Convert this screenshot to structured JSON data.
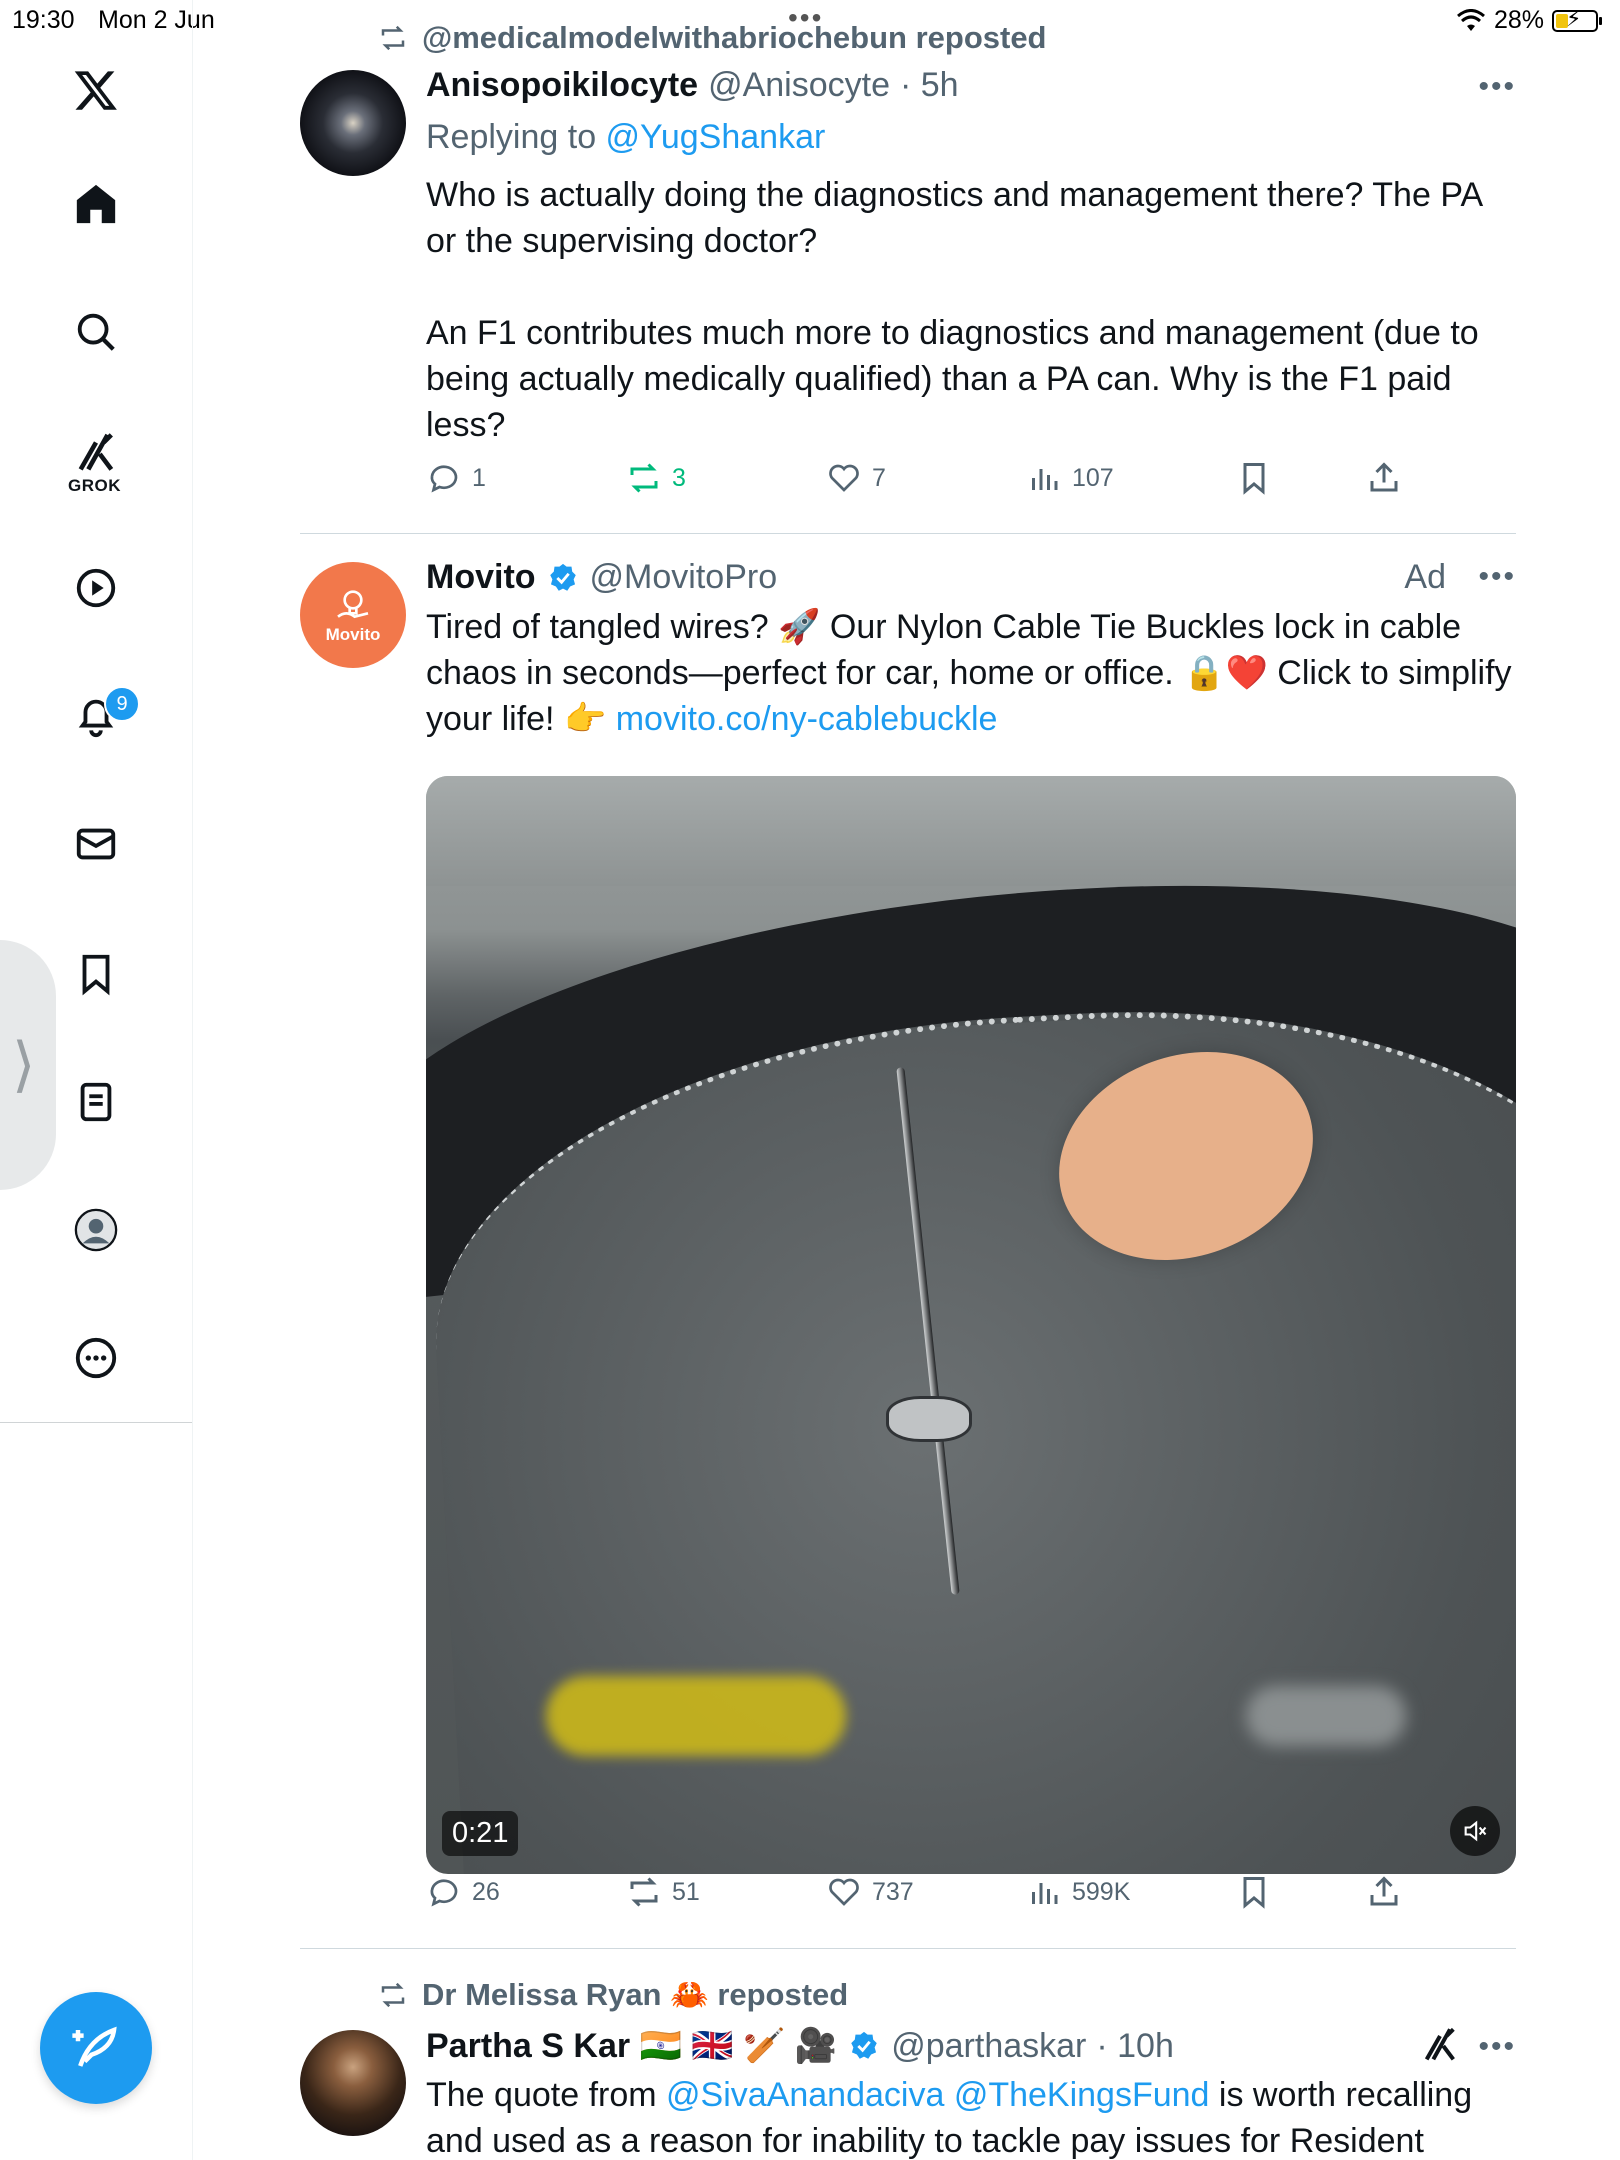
{
  "status_bar": {
    "time": "19:30",
    "date": "Mon 2 Jun",
    "battery": "28%",
    "battery_level": 0.28
  },
  "nav": {
    "grok_label": "GROK",
    "notifications_count": "9"
  },
  "posts": [
    {
      "repost_by": "@medicalmodelwithabriochebun reposted",
      "name": "Anisopoikilocyte",
      "handle": "@Anisocyte",
      "time": "· 5h",
      "replying_prefix": "Replying to ",
      "replying_to": "@YugShankar",
      "text_p1": "Who is actually doing the diagnostics and management there? The PA or the supervising doctor?",
      "text_p2": "An F1 contributes much more to diagnostics and management (due to being actually medically qualified) than a PA can. Why is the F1 paid less?",
      "replies": "1",
      "reposts": "3",
      "likes": "7",
      "views": "107"
    },
    {
      "name": "Movito",
      "handle": "@MovitoPro",
      "ad_label": "Ad",
      "avatar_text": "Movito",
      "text_main": "Tired of tangled wires? 🚀 Our Nylon Cable Tie Buckles lock in cable chaos in seconds—perfect for car, home or office. 🔒❤️ Click to simplify your life! 👉 ",
      "text_link": "movito.co/ny-cablebuckle",
      "video_duration": "0:21",
      "replies": "26",
      "reposts": "51",
      "likes": "737",
      "views": "599K"
    },
    {
      "repost_by": "Dr Melissa Ryan 🦀 reposted",
      "name": "Partha S Kar 🇮🇳 🇬🇧 🏏 🎥",
      "handle": "@parthaskar",
      "time": "· 10h",
      "text_prefix": "The quote from ",
      "mention1": "@SivaAnandaciva",
      "mention2": "@TheKingsFund",
      "text_rest": " is worth recalling and used as a reason for inability to tackle pay issues for Resident"
    }
  ],
  "colors": {
    "accent": "#1d9bf0",
    "repost_green": "#00ba7c",
    "secondary": "#536471"
  }
}
